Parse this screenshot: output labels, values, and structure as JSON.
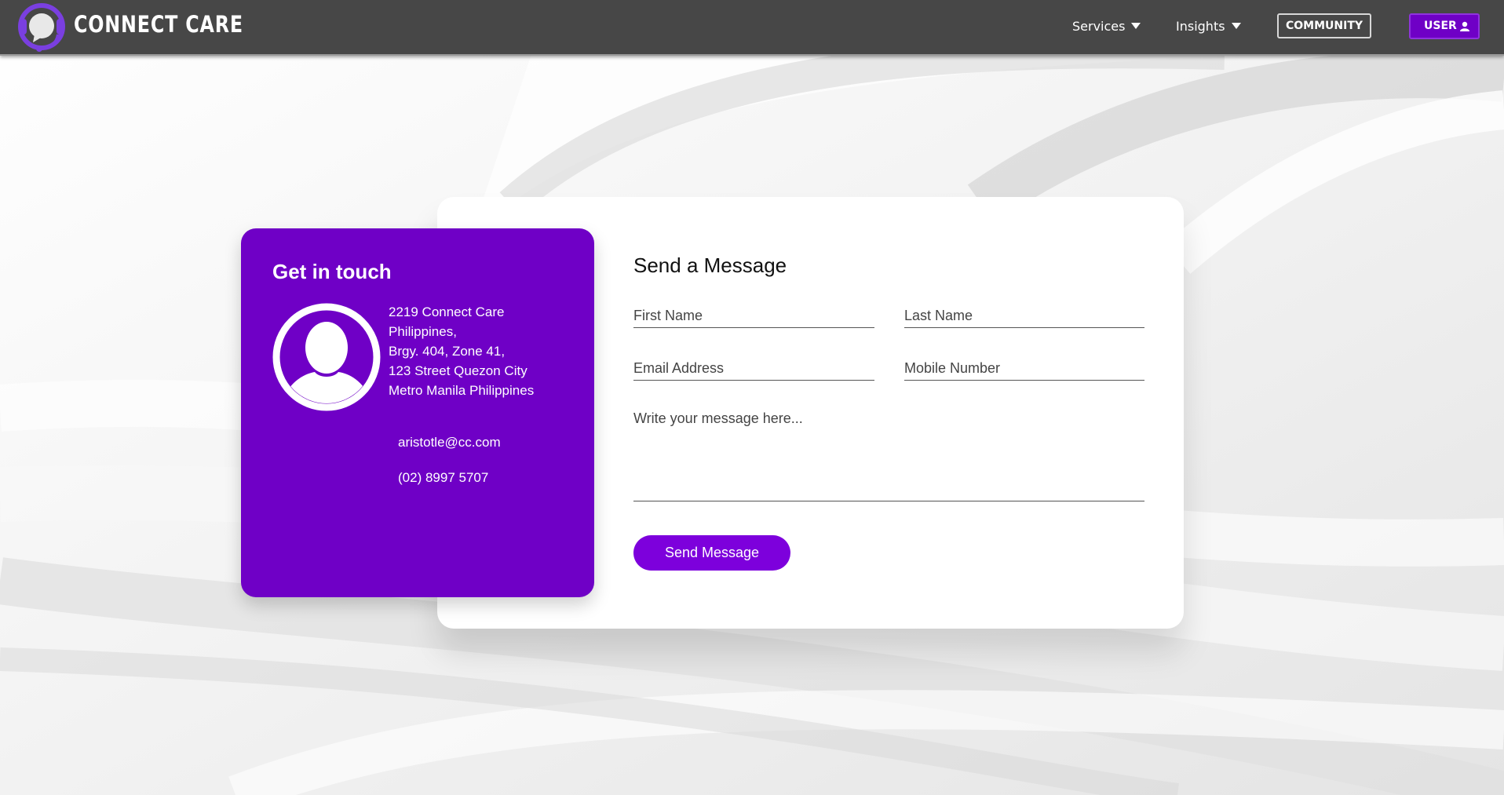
{
  "nav": {
    "brand": "CONNECT CARE",
    "services_label": "Services",
    "insights_label": "Insights",
    "community_label": "COMMUNITY",
    "user_label": "USER",
    "accent": "#6f00c6"
  },
  "contact": {
    "title": "Get in touch",
    "address_lines": [
      "2219 Connect Care",
      "Philippines,",
      "Brgy. 404, Zone 41,",
      "123 Street Quezon City",
      "Metro Manila Philippines"
    ],
    "email": "aristotle@cc.com",
    "phone": "(02) 8997 5707"
  },
  "form": {
    "title": "Send a Message",
    "first_name_placeholder": "First Name",
    "last_name_placeholder": "Last Name",
    "email_placeholder": "Email Address",
    "mobile_placeholder": "Mobile Number",
    "message_placeholder": "Write your message here...",
    "send_label": "Send Message"
  }
}
